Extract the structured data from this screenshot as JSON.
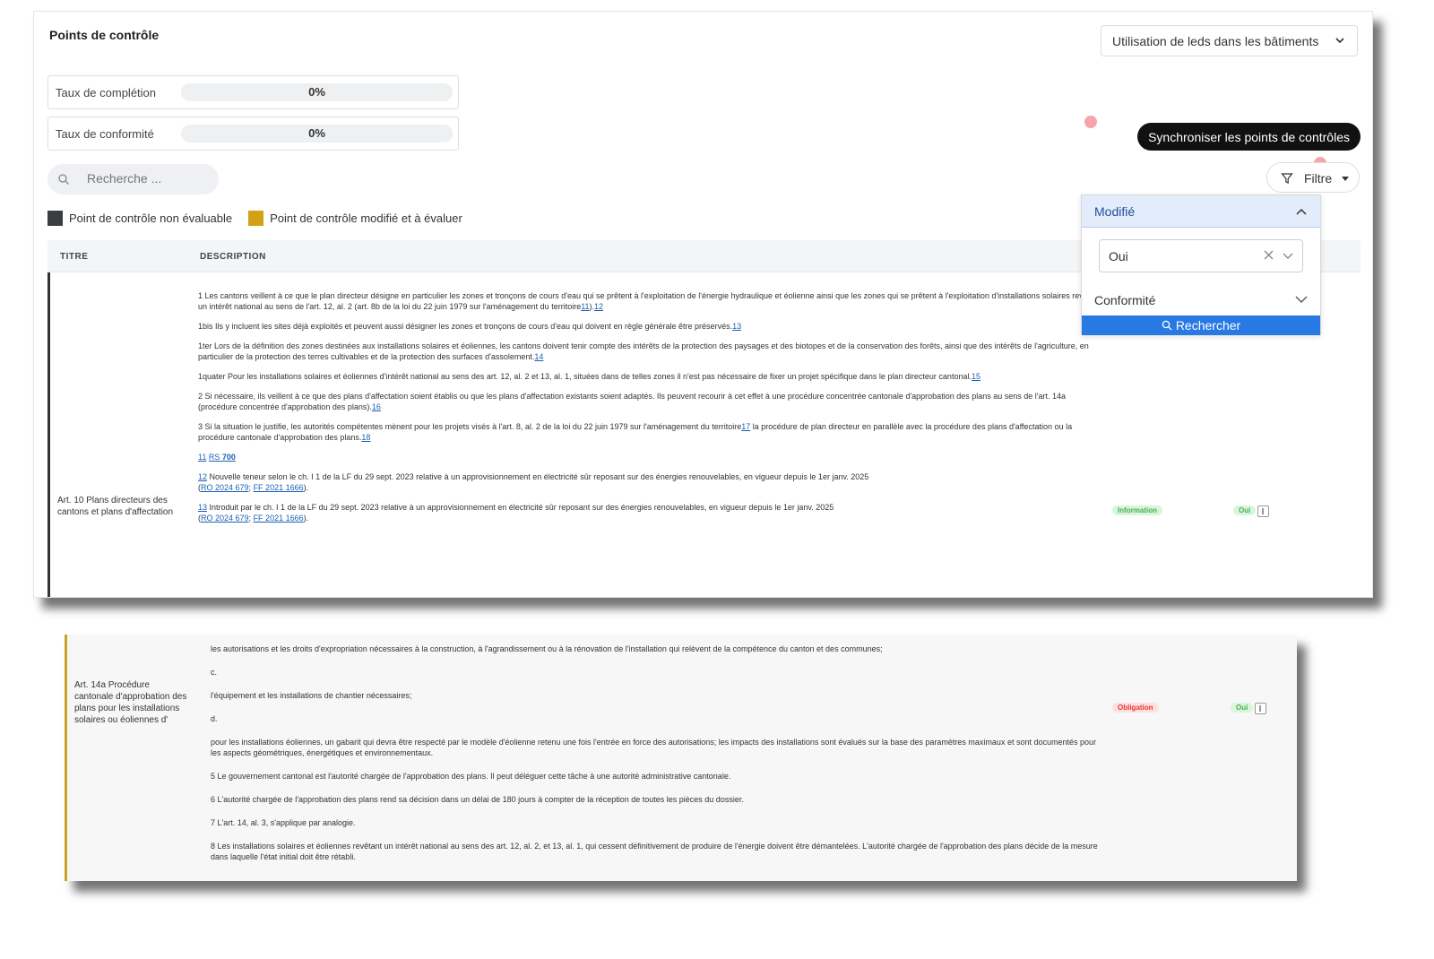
{
  "header": {
    "title": "Points de contrôle",
    "scenario_select": "Utilisation de leds dans les bâtiments"
  },
  "rates": [
    {
      "label": "Taux de complétion",
      "value": "0%",
      "fraction": 0
    },
    {
      "label": "Taux de conformité",
      "value": "0%",
      "fraction": 0
    }
  ],
  "actions": {
    "sync_button": "Synchroniser les points de contrôles",
    "filter_button": "Filtre"
  },
  "search": {
    "placeholder": "Recherche ..."
  },
  "legend": [
    {
      "label": "Point de contrôle non évaluable",
      "color": "#3a3d42"
    },
    {
      "label": "Point de contrôle modifié et à évaluer",
      "color": "#d4a017"
    }
  ],
  "table": {
    "headers": [
      "TITRE",
      "DESCRIPTION"
    ]
  },
  "filter_panel": {
    "section1_title": "Modifié",
    "section1_value": "Oui",
    "section2_title": "Conformité",
    "search_button": "Rechercher"
  },
  "row1": {
    "title": "Art. 10 Plans directeurs des cantons et plans d'affectation",
    "badge": "Information",
    "oui": "Oui",
    "p1": "1 Les cantons veillent à ce que le plan directeur désigne en particulier les zones et tronçons de cours d'eau qui se prêtent à l'exploitation de l'énergie hydraulique et éolienne ainsi que les zones qui se prêtent à l'exploitation d'installations solaires revêtant un intérêt national au sens de l'art. 12, al. 2 (art. 8b de la loi du 22 juin 1979 sur l'aménagement du territoire",
    "p1_l1": "11",
    "p1_mid": ").",
    "p1_l2": "12",
    "p2": "1bis Ils y incluent les sites déjà exploités et peuvent aussi désigner les zones et tronçons de cours d'eau qui doivent en règle générale être préservés.",
    "p2_l": "13",
    "p3": "1ter Lors de la définition des zones destinées aux installations solaires et éoliennes, les cantons doivent tenir compte des intérêts de la protection des paysages et des biotopes et de la conservation des forêts, ainsi que des intérêts de l'agriculture, en particulier de la protection des terres cultivables et de la protection des surfaces d'assolement.",
    "p3_l": "14",
    "p4": "1quater Pour les installations solaires et éoliennes d'intérêt national au sens des art. 12, al. 2 et 13, al. 1, situées dans de telles zones il n'est pas nécessaire de fixer un projet spécifique dans le plan directeur cantonal.",
    "p4_l": "15",
    "p5": "2 Si nécessaire, ils veillent à ce que des plans d'affectation soient établis ou que les plans d'affectation existants soient adaptés. Ils peuvent recourir à cet effet à une procédure concentrée cantonale d'approbation des plans au sens de l'art. 14a (procédure concentrée d'approbation des plans).",
    "p5_l": "16",
    "p6a": "3 Si la situation le justifie, les autorités compétentes mènent pour les projets visés à l'art. 8, al. 2 de la loi du 22 juin 1979 sur l'aménagement du territoire",
    "p6_l1": "17",
    "p6b": " la procédure de plan directeur en parallèle avec la procédure des plans d'affectation ou la procédure cantonale d'approbation des plans.",
    "p6_l2": "18",
    "fn11_num": "11",
    "fn11_rs": "RS",
    "fn11_val": "700",
    "fn12_num": "12",
    "fn12_text": " Nouvelle teneur selon le ch. I 1 de la LF du 29 sept. 2023 relative à un approvisionnement en électricité sûr reposant sur des énergies renouvelables, en vigueur depuis le 1er janv. 2025",
    "fn12_ro": "RO 2024 679",
    "fn12_ff": "FF 2021 1666",
    "fn13_num": "13",
    "fn13_text": " Introduit par le ch. I 1 de la LF du 29 sept. 2023 relative à un approvisionnement en électricité sûr reposant sur des énergies renouvelables, en vigueur depuis le 1er janv. 2025",
    "fn13_ro": "RO 2024 679",
    "fn13_ff": "FF 2021 1666"
  },
  "row2": {
    "title": "Art. 14a Procédure cantonale d'approbation des plans pour les installations solaires ou éoliennes d'",
    "badge": "Obligation",
    "oui": "Oui",
    "l1": "les autorisations et les droits d'expropriation nécessaires à la construction, à l'agrandissement ou à la rénovation de l'installation qui relèvent de la compétence du canton et des communes;",
    "l2": "c.",
    "l3": "l'équipement et les installations de chantier nécessaires;",
    "l4": "d.",
    "l5": "pour les installations éoliennes, un gabarit qui devra être respecté par le modèle d'éolienne retenu une fois l'entrée en force des autorisations; les impacts des installations sont évalués sur la base des paramètres maximaux et sont documentés pour les aspects géométriques, énergétiques et environnementaux.",
    "l6": "5 Le gouvernement cantonal est l'autorité chargée de l'approbation des plans. Il peut déléguer cette tâche à une autorité administrative cantonale.",
    "l7": "6 L'autorité chargée de l'approbation des plans rend sa décision dans un délai de 180 jours à compter de la réception de toutes les pièces du dossier.",
    "l8": "7 L'art. 14, al. 3, s'applique par analogie.",
    "l9": "8 Les installations solaires et éoliennes revêtant un intérêt national au sens des art. 12, al. 2, et 13, al. 1, qui cessent définitivement de produire de l'énergie doivent être démantelées. L'autorité chargée de l'approbation des plans décide de la mesure dans laquelle l'état initial doit être rétabli."
  }
}
